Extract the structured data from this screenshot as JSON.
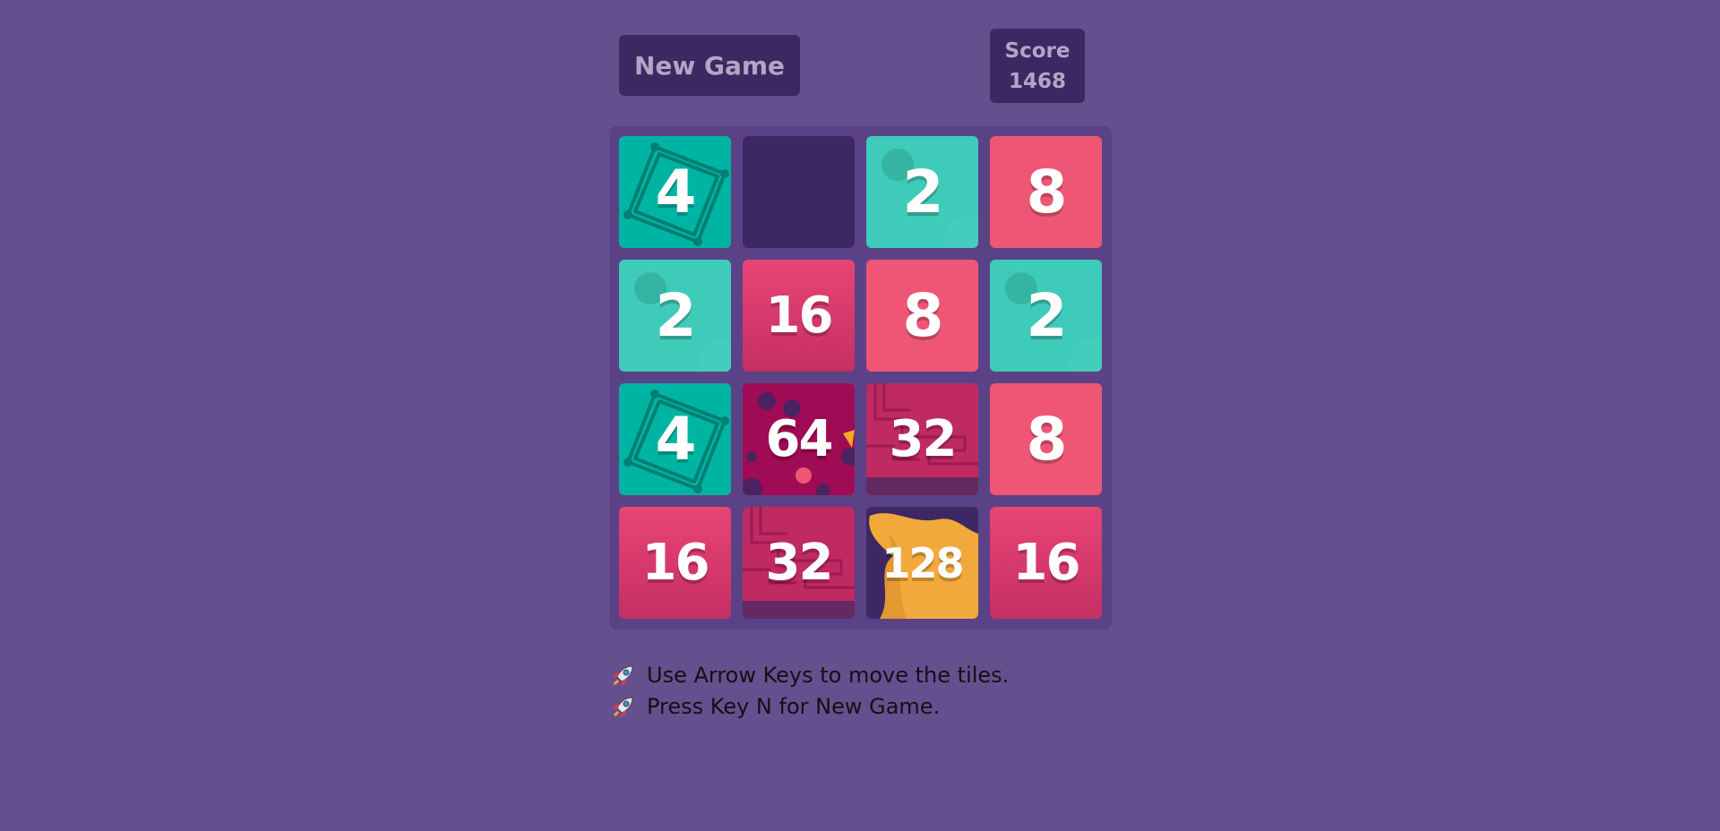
{
  "header": {
    "new_game_label": "New Game",
    "score_label": "Score",
    "score_value": "1468"
  },
  "board": {
    "rows": [
      [
        "4",
        "",
        "2",
        "8"
      ],
      [
        "2",
        "16",
        "8",
        "2"
      ],
      [
        "4",
        "64",
        "32",
        "8"
      ],
      [
        "16",
        "32",
        "128",
        "16"
      ]
    ]
  },
  "instructions": [
    {
      "icon": "rocket-icon",
      "text": "Use Arrow Keys to move the tiles."
    },
    {
      "icon": "rocket-icon",
      "text": "Press Key N for New Game."
    }
  ],
  "colors": {
    "background": "#664f8f",
    "panel": "#3d2863",
    "tile_2": "#3fcbb9",
    "tile_4": "#00b4a3",
    "tile_8": "#ef5675",
    "tile_16": "#d63a6c",
    "tile_32": "#c02a62",
    "tile_64": "#9f0b55",
    "tile_128": "#f2a93b"
  }
}
